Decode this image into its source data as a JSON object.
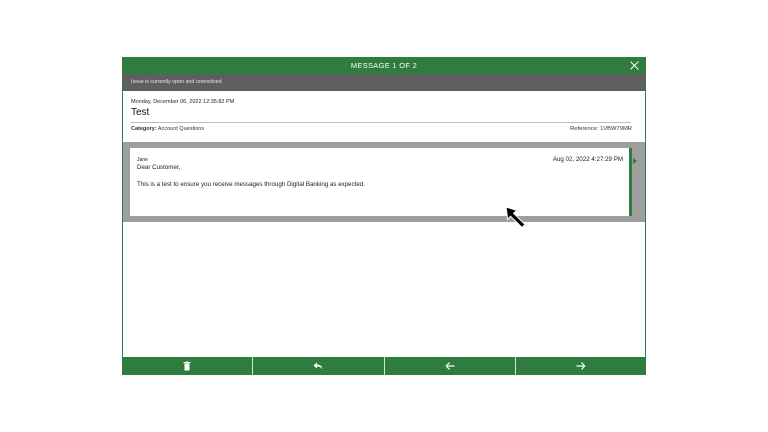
{
  "modal": {
    "title": "MESSAGE 1 OF 2"
  },
  "status": {
    "text": "Issue is currently open and unresolved"
  },
  "message_info": {
    "date": "Monday, December 06, 2022 12:35:82 PM",
    "subject": "Test",
    "category_label": "Category:",
    "category_value": "Account Questions",
    "reference_label": "Reference:",
    "reference_value": "1VBW79MR"
  },
  "thread": {
    "sender": "Jane",
    "greeting": "Dear Customer,",
    "timestamp": "Aug 02, 2022 4:27:29 PM",
    "body": "This is a test to ensure you receive messages through Digital Banking as expected."
  },
  "footer": {
    "buttons": [
      "trash-icon",
      "reply-icon",
      "arrow-left-icon",
      "arrow-right-icon"
    ]
  },
  "colors": {
    "brand": "#2e7d3e",
    "status_bar": "#5f5f5f",
    "thread_bg": "#9e9e9e"
  }
}
